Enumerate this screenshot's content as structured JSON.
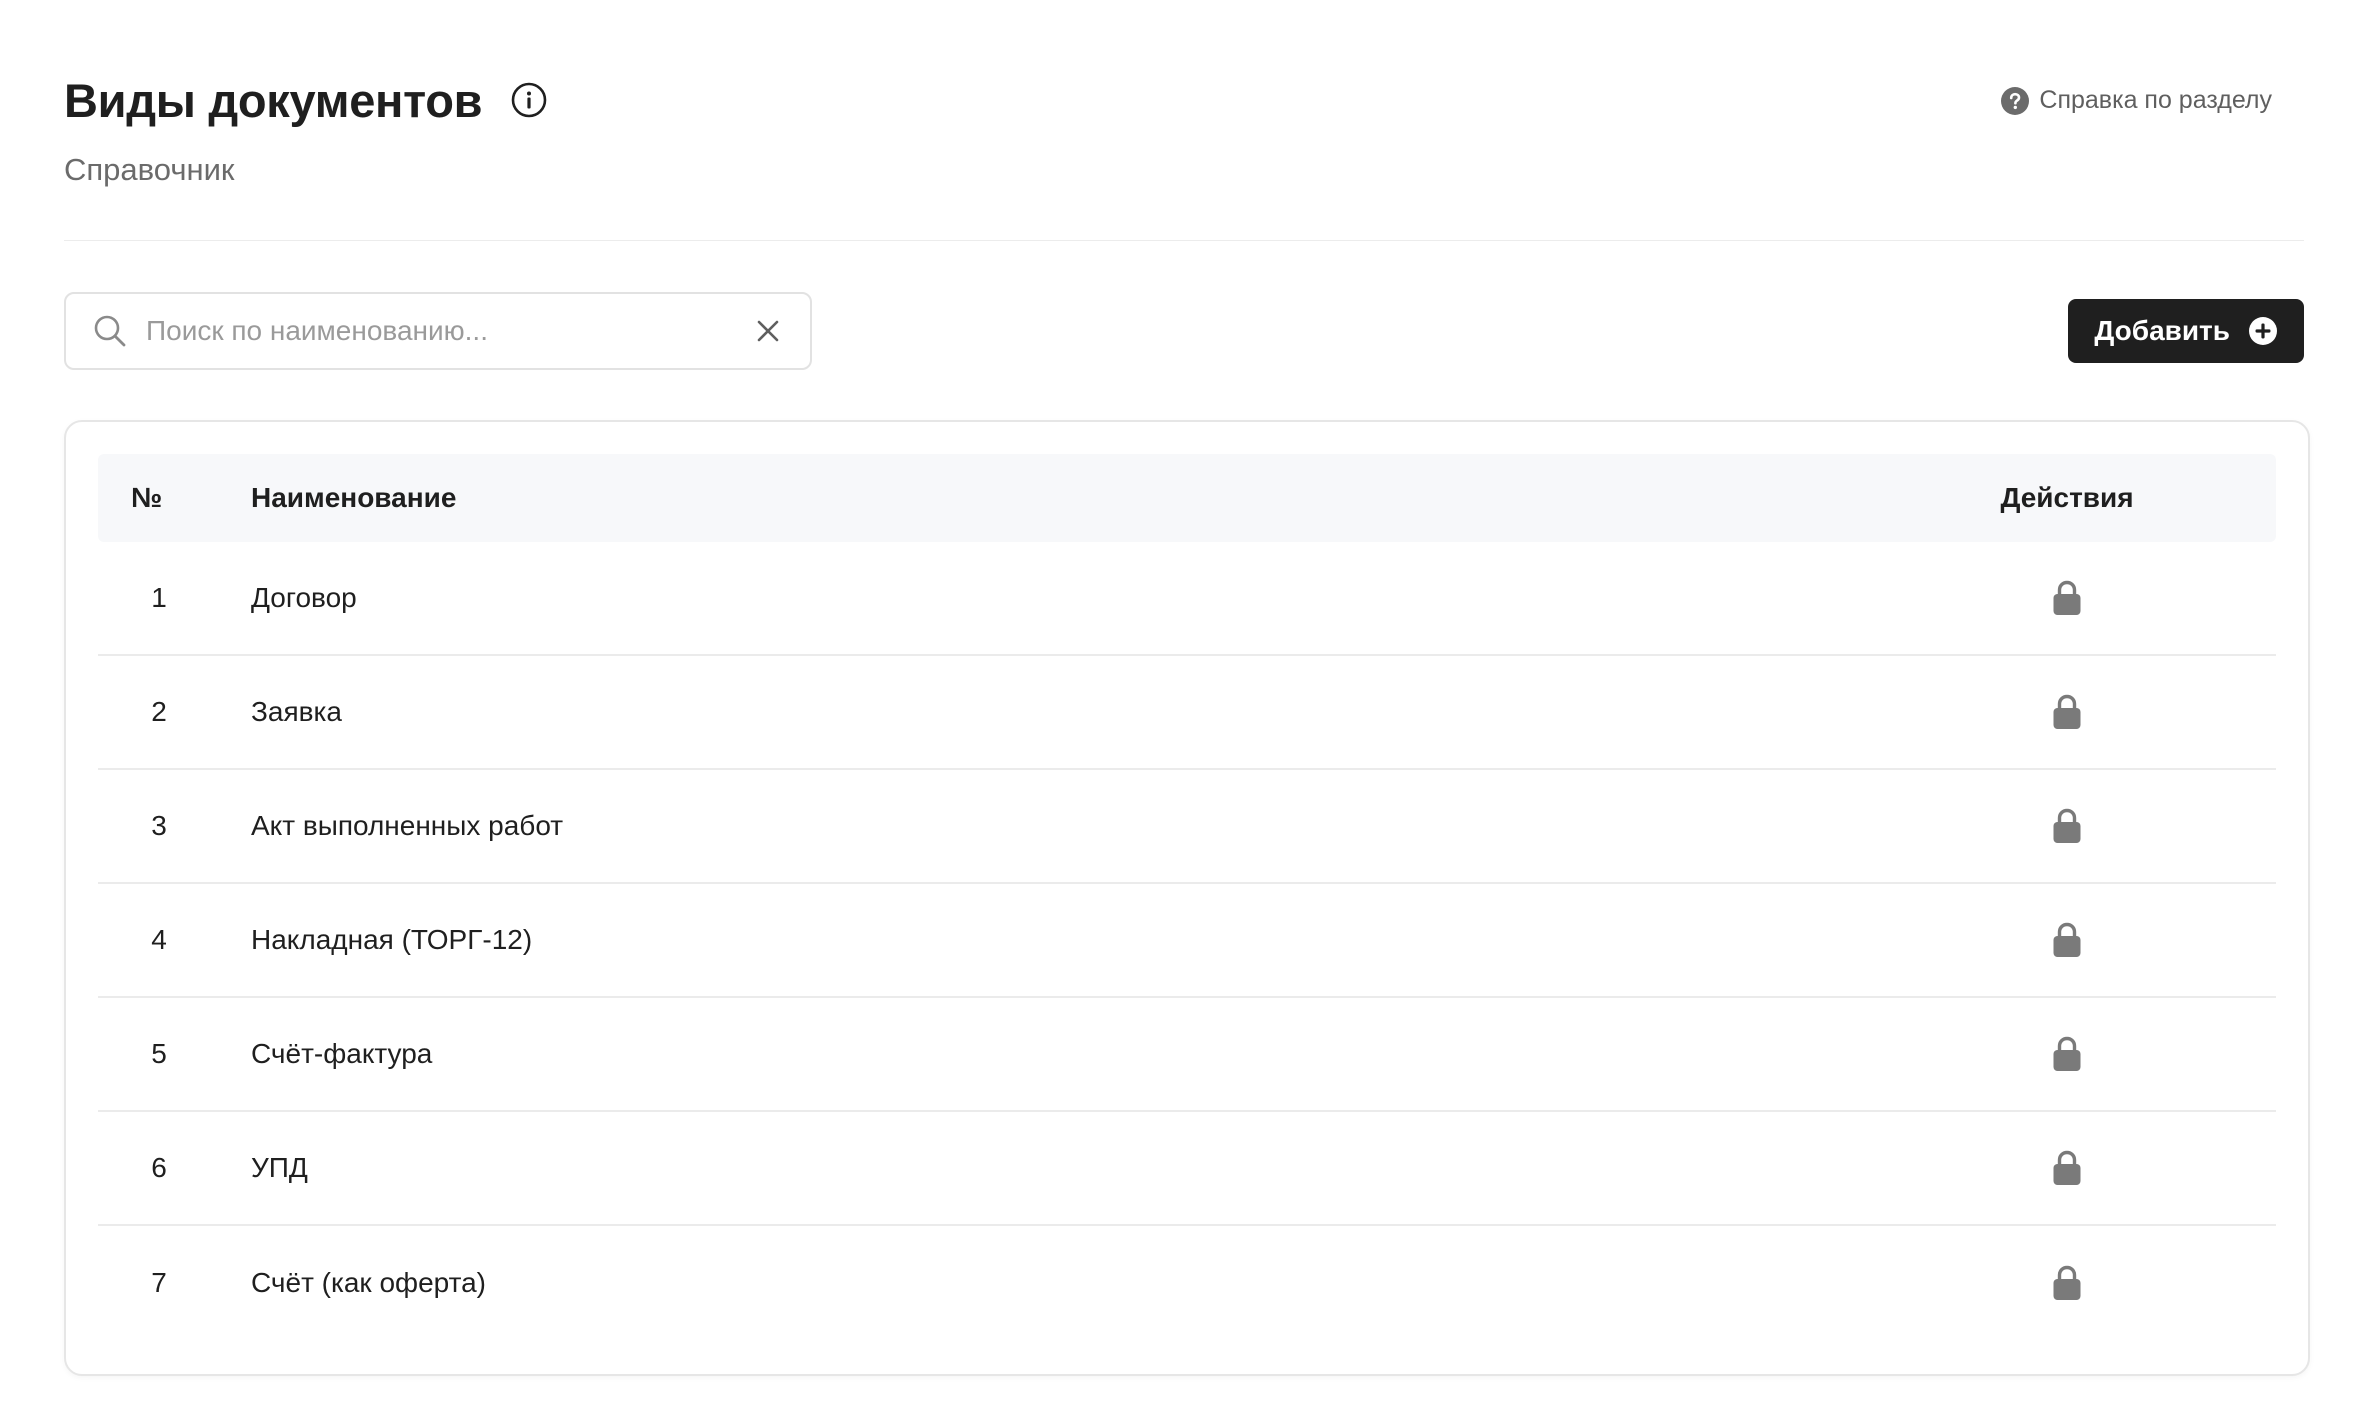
{
  "header": {
    "title": "Виды документов",
    "subtitle": "Справочник",
    "help_link": "Справка по разделу"
  },
  "toolbar": {
    "search_placeholder": "Поиск по наименованию...",
    "search_value": "",
    "add_button_label": "Добавить"
  },
  "table": {
    "columns": {
      "number": "№",
      "name": "Наименование",
      "actions": "Действия"
    },
    "rows": [
      {
        "number": "1",
        "name": "Договор",
        "action_icon": "lock-icon"
      },
      {
        "number": "2",
        "name": "Заявка",
        "action_icon": "lock-icon"
      },
      {
        "number": "3",
        "name": "Акт выполненных работ",
        "action_icon": "lock-icon"
      },
      {
        "number": "4",
        "name": "Накладная (ТОРГ-12)",
        "action_icon": "lock-icon"
      },
      {
        "number": "5",
        "name": "Счёт-фактура",
        "action_icon": "lock-icon"
      },
      {
        "number": "6",
        "name": "УПД",
        "action_icon": "lock-icon"
      },
      {
        "number": "7",
        "name": "Счёт (как оферта)",
        "action_icon": "lock-icon"
      }
    ]
  },
  "icons": {
    "title_info": "info-icon",
    "help": "question-circle-icon",
    "search": "search-icon",
    "clear": "close-icon",
    "add": "plus-circle-icon"
  },
  "colors": {
    "primary_button": "#1f1f1f",
    "text": "#1f1f1f",
    "muted_text": "#6b6b6b",
    "lock_icon": "#7a7a7a",
    "table_header_bg": "#f7f8fa"
  }
}
